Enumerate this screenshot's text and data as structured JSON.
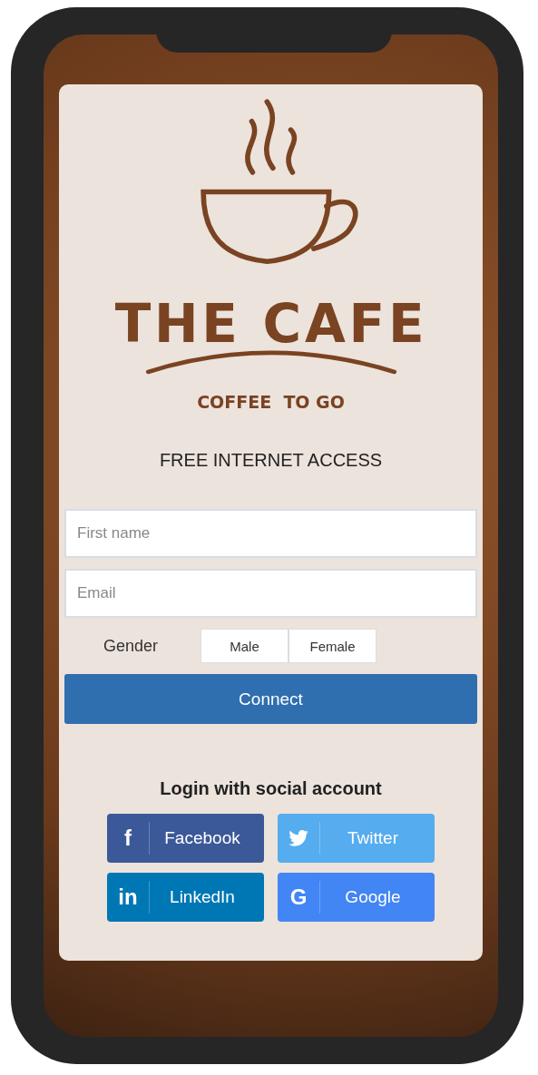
{
  "logo": {
    "title": "THE CAFE",
    "tagline": "COFFEE  TO GO"
  },
  "heading": "FREE INTERNET ACCESS",
  "fields": [
    {
      "placeholder": "First name"
    },
    {
      "placeholder": "Email"
    }
  ],
  "gender": {
    "label": "Gender",
    "options": [
      {
        "label": "Male",
        "selected": false
      },
      {
        "label": "Female",
        "selected": false
      }
    ]
  },
  "connect_button": "Connect",
  "social": {
    "title": "Login with social account",
    "buttons": [
      {
        "kind": "facebook",
        "icon": "f",
        "label": "Facebook",
        "color": "#3b5998"
      },
      {
        "kind": "twitter",
        "label": "Twitter",
        "color": "#55acee"
      },
      {
        "kind": "linkedin",
        "icon": "in",
        "label": "LinkedIn",
        "color": "#0077b5"
      },
      {
        "kind": "google",
        "icon": "G",
        "label": "Google",
        "color": "#4285f4"
      }
    ]
  }
}
